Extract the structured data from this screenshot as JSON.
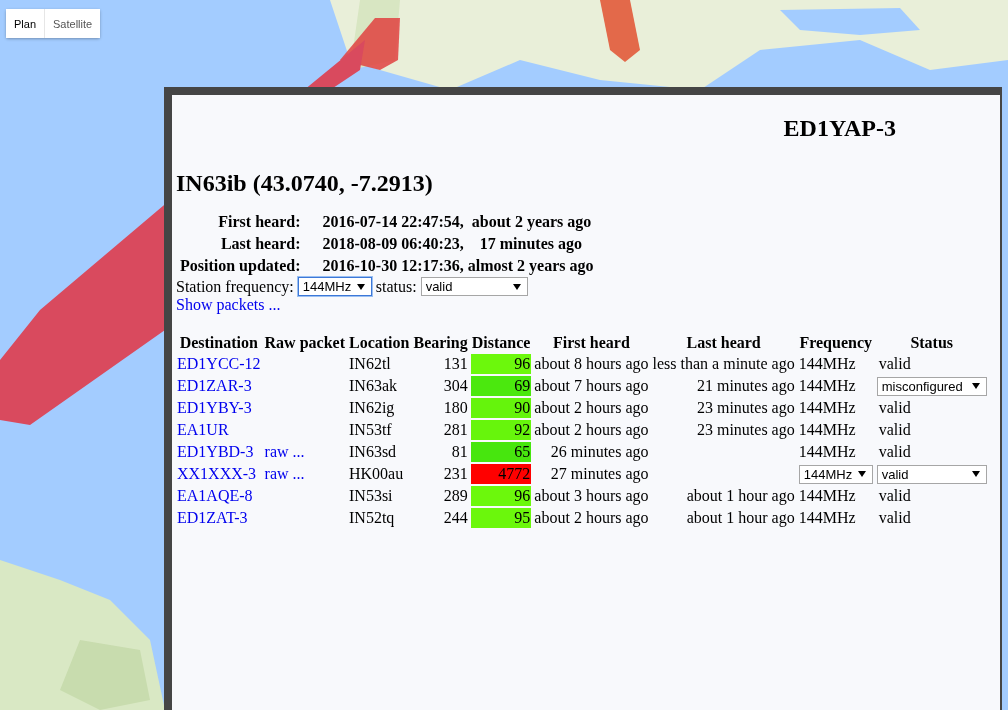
{
  "map_type_buttons": [
    {
      "label": "Plan",
      "selected": true
    },
    {
      "label": "Satellite",
      "selected": false
    }
  ],
  "station": {
    "callsign": "ED1YAP-3",
    "heading": "IN63ib (43.0740, -7.2913)",
    "info": [
      {
        "label": "First heard:",
        "value": "2016-07-14 22:47:54,  about 2 years ago"
      },
      {
        "label": "Last heard:",
        "value": "2018-08-09 06:40:23,    17 minutes ago"
      },
      {
        "label": "Position updated:",
        "value": "2016-10-30 12:17:36, almost 2 years ago"
      }
    ],
    "frequency_label": "Station frequency:",
    "frequency_value": "144MHz",
    "frequency_focused": true,
    "status_label": "status:",
    "status_value": "valid",
    "show_packets_link": "Show packets ..."
  },
  "table": {
    "columns": [
      "Destination",
      "Raw packet",
      "Location",
      "Bearing",
      "Distance",
      "First heard",
      "Last heard",
      "Frequency",
      "Status"
    ],
    "rows": [
      {
        "destination": "ED1YCC-12",
        "location": "IN62tl",
        "bearing": "131",
        "distance": "96",
        "color": "#6cf80c",
        "first_heard": "about 8 hours ago",
        "last_heard": "less than a minute ago",
        "frequency": {
          "kind": "text",
          "value": "144MHz"
        },
        "status": {
          "kind": "text",
          "value": "valid"
        }
      },
      {
        "destination": "ED1ZAR-3",
        "location": "IN63ak",
        "bearing": "304",
        "distance": "69",
        "color": "#4be80e",
        "first_heard": "about 7 hours ago",
        "last_heard": "21 minutes ago",
        "frequency": {
          "kind": "text",
          "value": "144MHz"
        },
        "status": {
          "kind": "select",
          "value": "misconfigured"
        }
      },
      {
        "destination": "ED1YBY-3",
        "location": "IN62ig",
        "bearing": "180",
        "distance": "90",
        "color": "#65f40c",
        "first_heard": "about 2 hours ago",
        "last_heard": "23 minutes ago",
        "frequency": {
          "kind": "text",
          "value": "144MHz"
        },
        "status": {
          "kind": "text",
          "value": "valid"
        }
      },
      {
        "destination": "EA1UR",
        "location": "IN53tf",
        "bearing": "281",
        "distance": "92",
        "color": "#67f50c",
        "first_heard": "about 2 hours ago",
        "last_heard": "23 minutes ago",
        "frequency": {
          "kind": "text",
          "value": "144MHz"
        },
        "status": {
          "kind": "text",
          "value": "valid"
        }
      },
      {
        "destination": "ED1YBD-3",
        "raw_packet": "raw ...",
        "location": "IN63sd",
        "bearing": "81",
        "distance": "65",
        "color": "#47e60e",
        "first_heard": "26 minutes ago",
        "frequency": {
          "kind": "text",
          "value": "144MHz"
        },
        "status": {
          "kind": "text",
          "value": "valid"
        }
      },
      {
        "destination": "XX1XXX-3",
        "raw_packet": "raw ...",
        "location": "HK00au",
        "bearing": "231",
        "distance": "4772",
        "color": "#ff0000",
        "first_heard": "27 minutes ago",
        "frequency": {
          "kind": "select",
          "value": "144MHz"
        },
        "status": {
          "kind": "select",
          "value": "valid"
        }
      },
      {
        "destination": "EA1AQE-8",
        "location": "IN53si",
        "bearing": "289",
        "distance": "96",
        "color": "#6cf80c",
        "first_heard": "about 3 hours ago",
        "last_heard": "about 1 hour ago",
        "frequency": {
          "kind": "text",
          "value": "144MHz"
        },
        "status": {
          "kind": "text",
          "value": "valid"
        }
      },
      {
        "destination": "ED1ZAT-3",
        "location": "IN52tq",
        "bearing": "244",
        "distance": "95",
        "color": "#6bf70c",
        "first_heard": "about 2 hours ago",
        "last_heard": "about 1 hour ago",
        "frequency": {
          "kind": "text",
          "value": "144MHz"
        },
        "status": {
          "kind": "text",
          "value": "valid"
        }
      }
    ]
  }
}
